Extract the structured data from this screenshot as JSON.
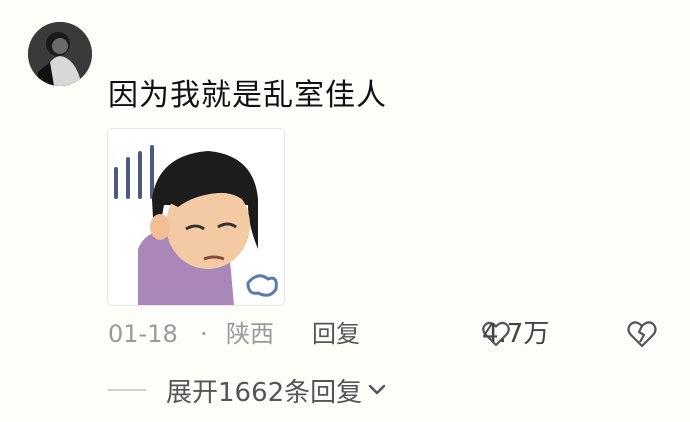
{
  "comment": {
    "text": "因为我就是乱室佳人",
    "sticker_icon": "sulking-cartoon-woman-sticker"
  },
  "meta": {
    "date": "01-18",
    "separator": "·",
    "location": "陕西",
    "reply_label": "回复"
  },
  "actions": {
    "like_count": "4.7万",
    "like_icon": "heart-outline-icon",
    "dislike_icon": "broken-heart-icon"
  },
  "replies": {
    "expand_label": "展开1662条回复"
  }
}
